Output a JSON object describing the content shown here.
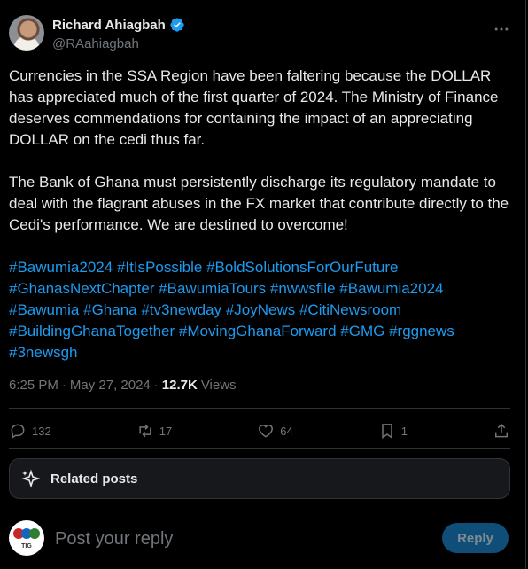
{
  "author": {
    "name": "Richard Ahiagbah",
    "handle": "@RAahiagbah"
  },
  "post": {
    "paragraph1": "Currencies in the SSA Region have been faltering because the DOLLAR has appreciated much of the first quarter of 2024. The Ministry of Finance deserves commendations for containing the impact of an appreciating DOLLAR on the cedi thus far.",
    "paragraph2": "The Bank of Ghana must persistently discharge its regulatory mandate to deal with the flagrant abuses in the FX market that contribute directly to the Cedi's performance. We are destined to overcome!",
    "hashtags": [
      "#Bawumia2024",
      "#ItIsPossible",
      "#BoldSolutionsForOurFuture",
      "#GhanasNextChapter",
      "#BawumiaTours",
      "#nwwsfile",
      "#Bawumia2024",
      "#Bawumia",
      "#Ghana",
      "#tv3newday",
      "#JoyNews",
      "#CitiNewsroom",
      "#BuildingGhanaTogether",
      "#MovingGhanaForward",
      "#GMG",
      "#rggnews",
      "#3newsgh"
    ]
  },
  "meta": {
    "time": "6:25 PM",
    "separator": "·",
    "date": "May 27, 2024",
    "views_count": "12.7K",
    "views_label": "Views"
  },
  "actions": {
    "replies": "132",
    "reposts": "17",
    "likes": "64",
    "bookmarks": "1"
  },
  "related": {
    "label": "Related posts"
  },
  "reply": {
    "placeholder": "Post your reply",
    "button_label": "Reply",
    "avatar_text": "TIG"
  },
  "colors": {
    "background": "#000000",
    "text": "#e7e9ea",
    "muted": "#71767b",
    "link": "#1d9bf0",
    "reply_button": "#0f4e78"
  }
}
